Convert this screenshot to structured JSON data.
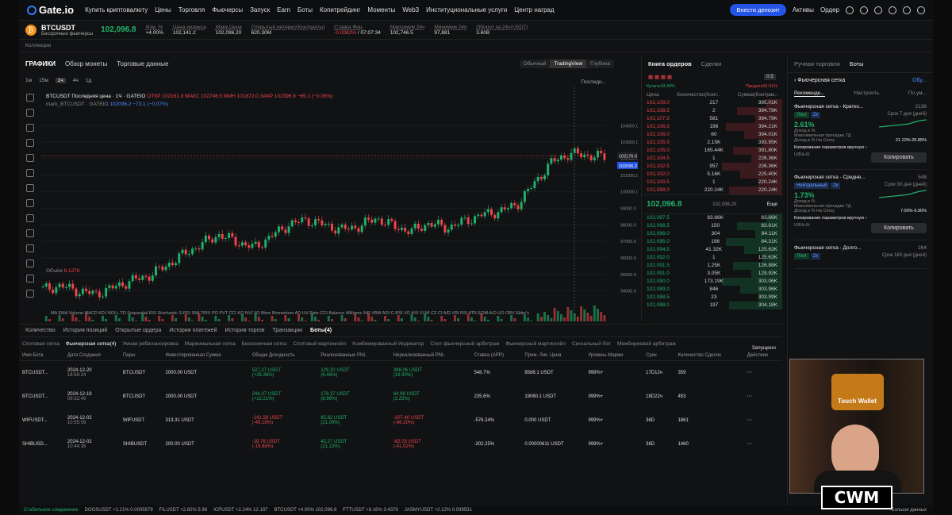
{
  "nav": {
    "logo": "Gate.io",
    "items": [
      "Купить криптовалюту",
      "Цены",
      "Торговля",
      "Фьючерсы",
      "Запуск",
      "Earn",
      "Боты",
      "Копитрейдинг",
      "Моменты",
      "Web3",
      "Институциональные услуги",
      "Центр наград"
    ],
    "deposit": "Внести депозит",
    "assets": "Активы",
    "order": "Ордер"
  },
  "ticker": {
    "pair": "BTCUSDT",
    "sub": "Бессрочные фьючерсы",
    "price": "102,096.8",
    "change_l": "Изм. %",
    "change_v": "+4.00%",
    "index_l": "Цена индекса",
    "index_v": "102,141.2",
    "mark_l": "Марк.Цена",
    "mark_v": "102,096.20",
    "oi_l": "Открытый интерес(Контракты)",
    "oi_v": "620.30M",
    "fund_l": "Ставка Фин.",
    "fund_v": "-0.0082%",
    "fund_t": "07:07:34",
    "max_l": "Максимум 24ч",
    "max_v": "102,746.5",
    "min_l": "Минимум 24ч",
    "min_v": "97,881",
    "turn_l": "Оборот за 24ч(USDT)",
    "turn_v": "3.60B"
  },
  "collections": "Коллекции",
  "chart": {
    "tabs": [
      "ГРАФИКИ",
      "Обзор монеты",
      "Торговые данные"
    ],
    "views": [
      "Обычный",
      "TradingView",
      "Глубина"
    ],
    "intervals": [
      "1м",
      "15м",
      "1ч",
      "4ч",
      "1д"
    ],
    "legend": "BTCUSDT Последняя цена · 1Ч · GATEIO",
    "ohlc": "ОТКР 102161.8 МАКС 102746.5 МИН 101872.0 ЗАКР 102096.8 −65.1 (−0.06%)",
    "mark": "mark_BTCUSDT · GATEIO",
    "markv": "102096.2 −73.1 (−0.07%)",
    "volume": "Объём",
    "volume_v": "6.127K",
    "last": "Последн...",
    "price_tag1": "102176.0",
    "price_tag2": "102096.2",
    "time_tag": "07 Янв '25",
    "time_tag2": "08:00",
    "indicators": "MA EMA Volume MACD KDJ BOLL TD Sequential RSI Stochastic S-RSI SMI TRIX PO PVT CCI KO NVI VO Mom Momentum AO HV Rate CCI Balance Williams %R VBW ADI C-RSI VO ASI VI MI CZ CI A/D VRI RSI ATR EOM A/O UO OBV Elder's"
  },
  "chart_data": {
    "type": "candlestick",
    "x_labels": [
      "30",
      "31",
      "2025",
      "2",
      "3",
      "4",
      "5",
      "6",
      "7"
    ],
    "y_ticks": [
      104000,
      103000,
      102000,
      101000,
      100000,
      99000,
      98000,
      97000,
      96000,
      95000,
      94000
    ],
    "closes": [
      94100,
      94300,
      94000,
      93800,
      94200,
      94600,
      94900,
      95500,
      96200,
      96800,
      97400,
      97000,
      96600,
      97300,
      98000,
      98300,
      98000,
      97700,
      97900,
      98400,
      97900,
      97600,
      98100,
      97800,
      98200,
      98600,
      98800,
      99200,
      100500,
      101800,
      102300,
      102200,
      102096.8
    ]
  },
  "orderbook": {
    "tabs": [
      "Книга ордеров",
      "Сделки"
    ],
    "step": "0.5",
    "buy_pct": "Купить43.49%",
    "sell_pct": "Продать56.51%",
    "headers": [
      "Цена",
      "Количество(Конт..",
      "Сумма(Контрак.."
    ],
    "asks": [
      [
        "102,109.0",
        "217",
        "395.01K"
      ],
      [
        "102,108.5",
        "2",
        "394.79K"
      ],
      [
        "102,107.5",
        "581",
        "394.79K"
      ],
      [
        "102,106.5",
        "198",
        "394.21K"
      ],
      [
        "102,106.0",
        "60",
        "394.01K"
      ],
      [
        "102,105.5",
        "2.15K",
        "393.95K"
      ],
      [
        "102,105.0",
        "165.44K",
        "391.80K"
      ],
      [
        "102,104.5",
        "1",
        "226.36K"
      ],
      [
        "102,102.5",
        "957",
        "226.36K"
      ],
      [
        "102,102.0",
        "5.16K",
        "225.40K"
      ],
      [
        "102,100.5",
        "1",
        "220.24K"
      ],
      [
        "102,098.0",
        "220.24K",
        "220.24K"
      ]
    ],
    "mid": "102,096.8",
    "mid_sub": "102,096.20",
    "more": "Еще",
    "bids": [
      [
        "102,097.5",
        "83.66K",
        "83.66K"
      ],
      [
        "102,096.5",
        "150",
        "83.81K"
      ],
      [
        "102,096.0",
        "304",
        "84.11K"
      ],
      [
        "102,095.0",
        "196",
        "84.31K"
      ],
      [
        "102,094.5",
        "41.32K",
        "125.63K"
      ],
      [
        "102,092.0",
        "1",
        "125.63K"
      ],
      [
        "102,091.5",
        "1.25K",
        "126.88K"
      ],
      [
        "102,091.0",
        "3.05K",
        "129.93K"
      ],
      [
        "102,090.0",
        "173.19K",
        "303.06K"
      ],
      [
        "102,089.0",
        "846",
        "303.96K"
      ],
      [
        "102,088.5",
        "23",
        "303.99K"
      ],
      [
        "102,088.0",
        "197",
        "304.18K"
      ]
    ]
  },
  "bots": {
    "tabs": [
      "Ручная торговля",
      "Боты"
    ],
    "title": "Фьючерсная сетка",
    "more": "Обу...",
    "subtabs": [
      "Рекоменде...",
      "Настроить",
      "По ум..."
    ],
    "cards": [
      {
        "name": "Фьючерсная сетка - Кратко...",
        "count": "2136",
        "tag": "Лонг",
        "lev": "2x",
        "term": "Срок 7 дня (дней)",
        "pct": "2.61%",
        "pct_l": "Доход в %",
        "dd_l": "Максимальная просадка 7Д",
        "apr_l": "Доход в % На Сетку",
        "apr_v": "21.10%-26.85%",
        "copy": "Копирование параметров вручную",
        "ai": "Ultra AI",
        "btn": "Копировать"
      },
      {
        "name": "Фьючерсная сетка - Средне...",
        "count": "548",
        "tag": "Нейтральный",
        "lev": "2x",
        "term": "Срок 30 дня (дней)",
        "pct": "1.73%",
        "pct_l": "Доход в %",
        "dd_l": "Максимальная просадка 7Д",
        "apr_l": "Доход в % На Сетку",
        "apr_v": "7.00%-9.90%",
        "copy": "Копирование параметров вручную",
        "ai": "Ultra AI",
        "btn": "Копировать"
      },
      {
        "name": "Фьючерсная сетка - Долго...",
        "count": "264",
        "tag": "Лонг",
        "lev": "2x",
        "term": "Срок 180 дня (дней)"
      }
    ]
  },
  "bottom": {
    "tabs": [
      "Количество",
      "История позиций",
      "Открытые ордера",
      "История платежей",
      "История торгов",
      "Транзакции",
      "Боты(4)"
    ],
    "subtabs": [
      "Спотовая сетка",
      "Фьючерсная сетка(4)",
      "Умная ребалансировка",
      "Маржинальная сетка",
      "Бесконечная сетка",
      "Спотовый мартингейл",
      "Комбинированный Индикатор",
      "Спот-фьючерсный арбитраж",
      "Фьючерсный мартингейл",
      "Сигнальный бот",
      "Межбиржевой арбитраж"
    ],
    "running": "Запущено",
    "headers": [
      "Имя Бота",
      "Дата Создания",
      "Пары",
      "Инвестированная Сумма",
      "Общая Доходность",
      "Реализованные PNL",
      "Нереализованный PNL",
      "Ставка (APR)",
      "Прим. Лик. Цена",
      "Уровень Маржи",
      "Срок",
      "Количество Сделок",
      "Действие"
    ],
    "rows": [
      [
        "BTCUSDT...",
        "2024-12-20",
        "18:58:24",
        "BTCUSDT",
        "2000.00 USDT",
        "527.27 USDT",
        "(+26.36%)",
        "129.20 USDT",
        "(6.46%)",
        "398.06 USDT",
        "(19.90%)",
        "548.7%",
        "8588.1 USDT",
        "999%+",
        "17D12ч",
        "359"
      ],
      [
        "BTCUSDT...",
        "2024-12-19",
        "09:32:49",
        "BTCUSDT",
        "2000.00 USDT",
        "244.37 USDT",
        "(+12.21%)",
        "179.37 USDT",
        "(8.96%)",
        "64.99 USDT",
        "(3.25%)",
        "235.6%",
        "19060.1 USDT",
        "999%+",
        "18D22ч",
        "453"
      ],
      [
        "WIFUSDT...",
        "2024-12-02",
        "10:55:09",
        "WIFUSDT",
        "313.31 USDT",
        "-141.58 USDT",
        "(-45.18%)",
        "65.82 USDT",
        "(21.00%)",
        "-207.40 USDT",
        "(-66.20%)",
        "-576.24%",
        "0.000 USDT",
        "999%+",
        "36D",
        "1861"
      ],
      [
        "SHIBUSD...",
        "2024-12-02",
        "10:44:38",
        "SHIBUSDT",
        "200.00 USDT",
        "-39.76 USDT",
        "(-19.88%)",
        "42.27 USDT",
        "(21.13%)",
        "-82.03 USDT",
        "(-41.02%)",
        "-202.25%",
        "0.00000611 USDT",
        "999%+",
        "36D",
        "1460"
      ]
    ]
  },
  "status": {
    "conn": "Стабильное соединение",
    "items": [
      "DOGSUSDT +2.21% 0.0005679",
      "FILUSDT +2.82% 5.98",
      "ICPUSDT +2.24% 12.187",
      "BTCUSDT +4.00% 102,096.8",
      "FTTUSDT +8.16% 3.4379",
      "JASMYUSDT +2.12% 0.039531"
    ],
    "right": "Больше данных",
    "news": "Новост.."
  },
  "overlay": {
    "wallet": "Touch Wallet",
    "logo": "CWM"
  }
}
